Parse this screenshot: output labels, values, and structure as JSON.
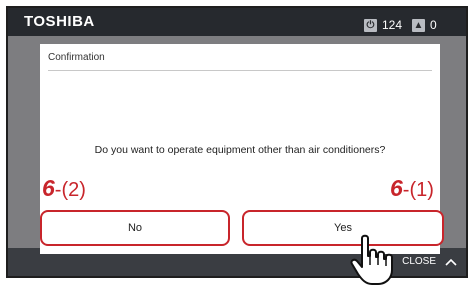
{
  "header": {
    "brand": "TOSHIBA",
    "top_info": "",
    "power_count": "124",
    "power_icon_glyph": "⏻",
    "alarm_count": "0",
    "alarm_icon_glyph": "▲"
  },
  "dialog": {
    "title": "Confirmation",
    "message": "Do you want to operate equipment other than air conditioners?",
    "no_label": "No",
    "yes_label": "Yes"
  },
  "annotations": {
    "no_step_number": "6",
    "no_step_suffix": "-(2)",
    "yes_step_number": "6",
    "yes_step_suffix": "-(1)"
  },
  "footer": {
    "close_label": "CLOSE"
  },
  "colors": {
    "accent_red": "#c8252b",
    "screen_bg": "#7d7d80",
    "topbar_bg": "#26292e"
  },
  "icons": [
    "power-icon",
    "alarm-icon",
    "chevron-up-icon",
    "pointing-hand-icon"
  ]
}
